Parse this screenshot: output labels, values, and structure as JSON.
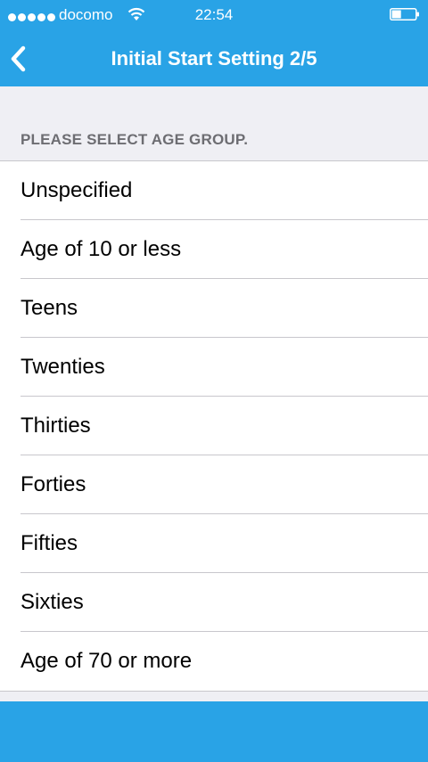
{
  "status_bar": {
    "carrier": "docomo",
    "time": "22:54",
    "signal_bars": 5,
    "battery_level": 0.4,
    "icons": [
      "signal-icon",
      "wifi-icon",
      "battery-icon"
    ]
  },
  "nav": {
    "title": "Initial Start Setting 2/5",
    "back_icon": "chevron-left-icon"
  },
  "section_header": "PLEASE SELECT AGE GROUP.",
  "age_groups": [
    "Unspecified",
    "Age of 10 or less",
    "Teens",
    "Twenties",
    "Thirties",
    "Forties",
    "Fifties",
    "Sixties",
    "Age of 70 or more"
  ],
  "colors": {
    "accent": "#29a3e6",
    "background": "#efeff4",
    "separator": "#c8c7cc",
    "section_header_text": "#6d6d72"
  }
}
